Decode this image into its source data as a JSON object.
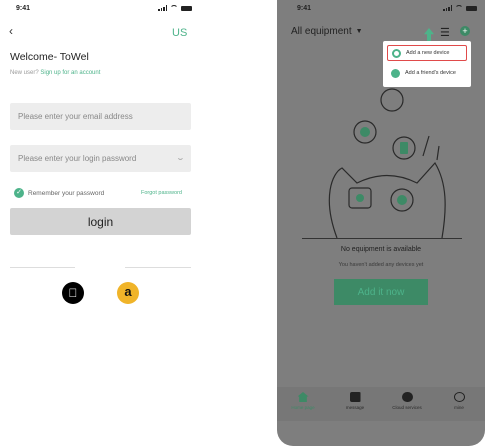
{
  "left": {
    "status": {
      "time": "9:41"
    },
    "language": "US",
    "welcome": "Welcome- ToWel",
    "new_user_prefix": "New user?",
    "signup_link": "Sign up for an account",
    "email_placeholder": "Please enter your email address",
    "password_placeholder": "Please enter your login password",
    "remember_label": "Remember your password",
    "forgot_label": "Forgot password",
    "login_label": "login",
    "icons": {
      "back": "chevron-left-icon",
      "eye": "eye-closed-icon",
      "apple": "apple-icon",
      "amazon": "amazon-icon"
    }
  },
  "right": {
    "status": {
      "time": "9:41"
    },
    "header_title": "All equipment",
    "menu": [
      {
        "label": "Add a new device"
      },
      {
        "label": "Add a friend's device"
      }
    ],
    "empty_title": "No equipment is available",
    "empty_sub": "You haven't added any devices yet",
    "add_now_label": "Add it now",
    "tabs": [
      {
        "label": "Home page",
        "icon": "home-icon",
        "active": true
      },
      {
        "label": "message",
        "icon": "message-icon",
        "active": false
      },
      {
        "label": "Cloud services",
        "icon": "cloud-icon",
        "active": false
      },
      {
        "label": "mine",
        "icon": "user-icon",
        "active": false
      }
    ]
  },
  "colors": {
    "accent": "#4db38a",
    "accent_dark": "#3d8a66",
    "overlay": "#7e7e7e",
    "highlight": "#e04a4a"
  }
}
